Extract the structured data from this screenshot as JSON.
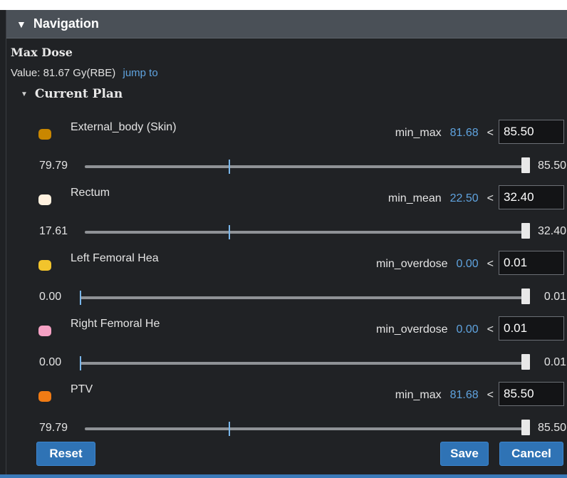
{
  "header": {
    "title": "Navigation"
  },
  "summary": {
    "title": "Max Dose",
    "value_label": "Value:",
    "value": "81.67 Gy(RBE)",
    "link": "jump to"
  },
  "plan": {
    "title": "Current Plan",
    "rows": [
      {
        "name": "External_body (Skin)",
        "swatch_color": "#c98700",
        "metric": "min_max",
        "value": "81.68",
        "operator": "<",
        "threshold": "85.50",
        "range_min": "79.79",
        "range_max": "85.50",
        "marker_fraction": 0.34,
        "handle_fraction": 1.0
      },
      {
        "name": "Rectum",
        "swatch_color": "#fff1df",
        "metric": "min_mean",
        "value": "22.50",
        "operator": "<",
        "threshold": "32.40",
        "range_min": "17.61",
        "range_max": "32.40",
        "marker_fraction": 0.34,
        "handle_fraction": 1.0
      },
      {
        "name": "Left Femoral Hea",
        "swatch_color": "#f2c42c",
        "metric": "min_overdose",
        "value": "0.00",
        "operator": "<",
        "threshold": "0.01",
        "range_min": "0.00",
        "range_max": "0.01",
        "marker_fraction": 0.0,
        "handle_fraction": 1.0
      },
      {
        "name": "Right Femoral He",
        "swatch_color": "#f5a1c4",
        "metric": "min_overdose",
        "value": "0.00",
        "operator": "<",
        "threshold": "0.01",
        "range_min": "0.00",
        "range_max": "0.01",
        "marker_fraction": 0.0,
        "handle_fraction": 1.0
      },
      {
        "name": "PTV",
        "swatch_color": "#f07b14",
        "metric": "min_max",
        "value": "81.68",
        "operator": "<",
        "threshold": "85.50",
        "range_min": "79.79",
        "range_max": "85.50",
        "marker_fraction": 0.34,
        "handle_fraction": 1.0
      }
    ]
  },
  "buttons": {
    "reset": "Reset",
    "save": "Save",
    "cancel": "Cancel"
  },
  "theme": {
    "accent": "#2f73b5",
    "link": "#5fa3df",
    "header_bg": "#4a5057"
  }
}
